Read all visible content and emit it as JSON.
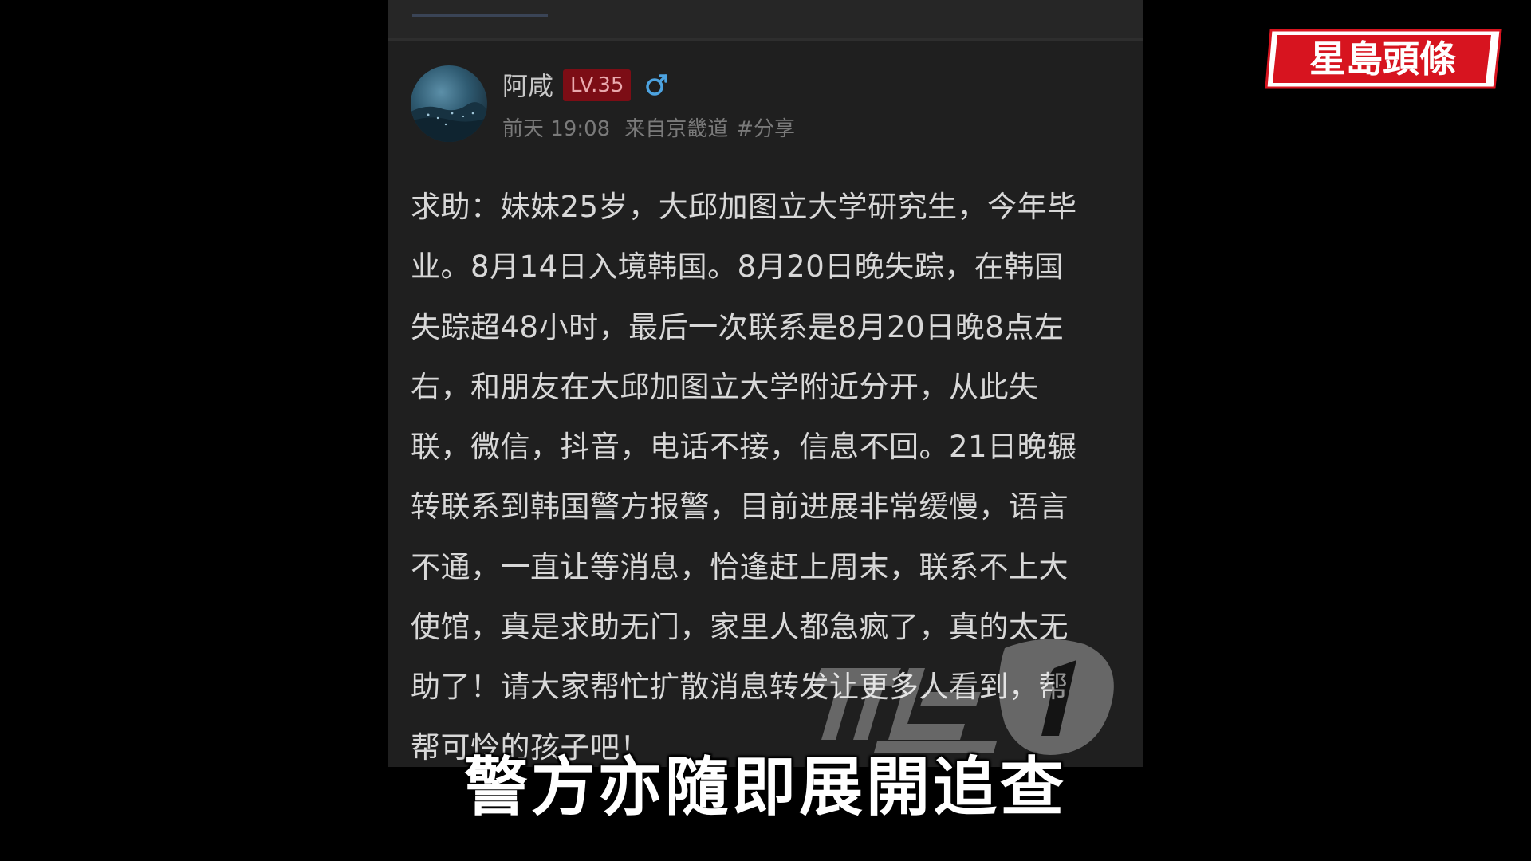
{
  "post": {
    "username": "阿咸",
    "level": "LV.35",
    "gender_icon": "male-symbol-icon",
    "time": "前天 19:08",
    "source": "来自京畿道",
    "tag": "#分享",
    "body_lines": [
      "求助：妹妹25岁，大邱加图立大学研究生，今年毕",
      "业。8月14日入境韩国。8月20日晚失踪，在韩国",
      "失踪超48小时，最后一次联系是8月20日晚8点左",
      "右，和朋友在大邱加图立大学附近分开，从此失",
      "联，微信，抖音，电话不接，信息不回。21日晚辗",
      "转联系到韩国警方报警，目前进展非常缓慢，语言",
      "不通，一直让等消息，恰逢赶上周末，联系不上大",
      "使馆，真是求助无门，家里人都急疯了，真的太无",
      "助了！请大家帮忙扩散消息转发让更多人看到，帮",
      "帮可怜的孩子吧！"
    ]
  },
  "watermark": "뉴스1",
  "logo": {
    "text": "星島頭條",
    "color": "#d7141f"
  },
  "subtitle": "警方亦隨即展開追查",
  "colors": {
    "level_badge_bg": "#7c0d15",
    "gender_icon": "#4da3e0"
  }
}
